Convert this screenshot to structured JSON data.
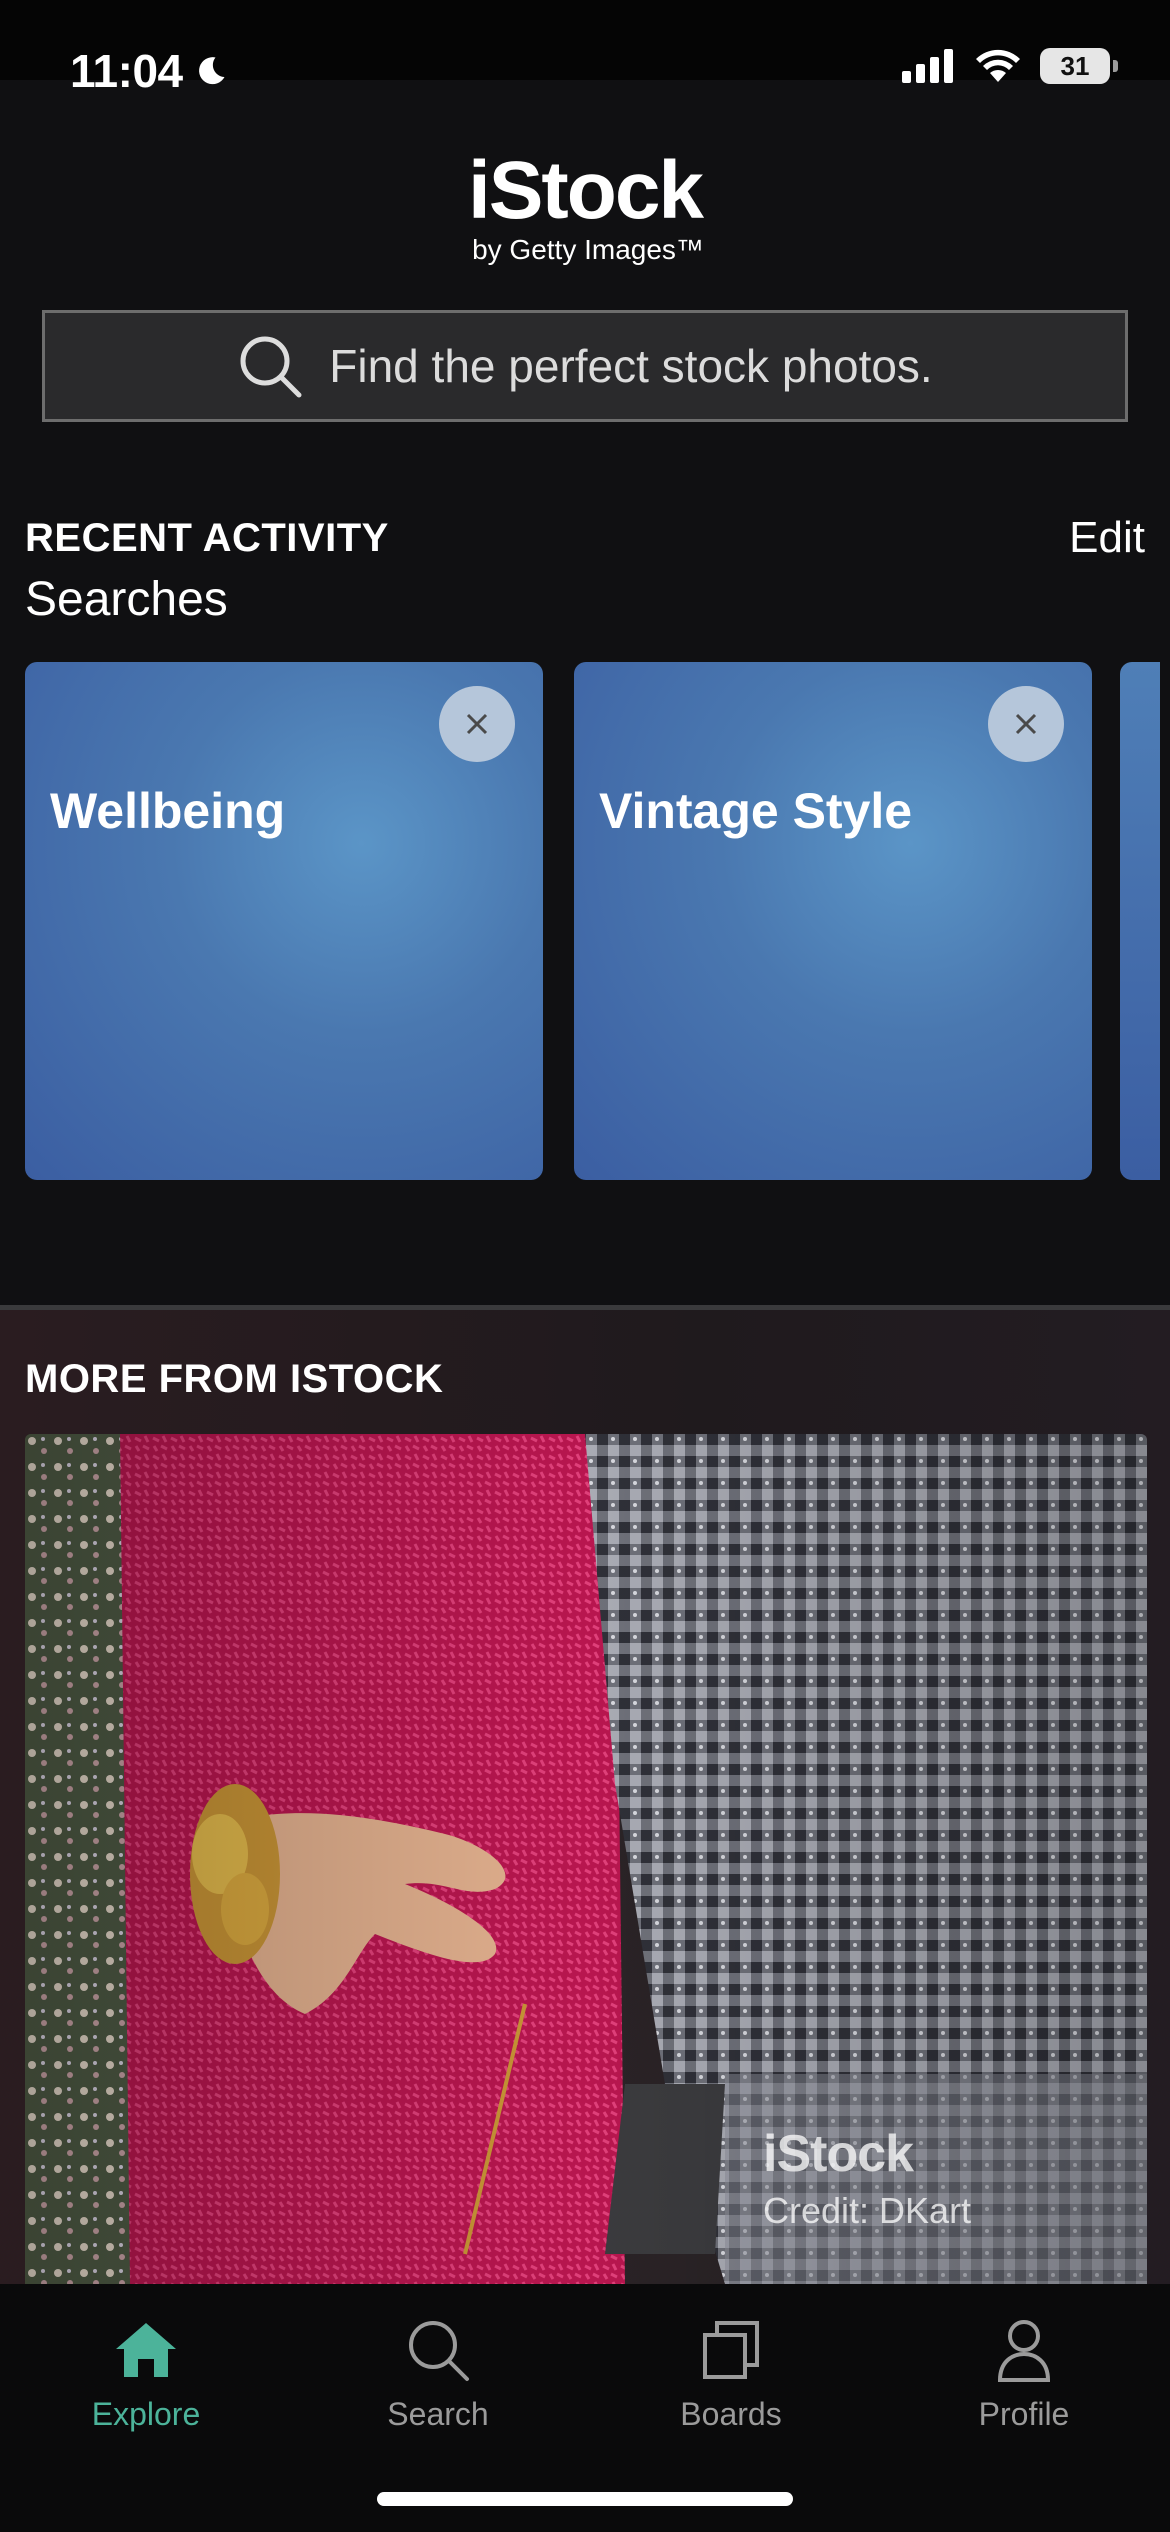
{
  "status_bar": {
    "time": "11:04",
    "battery": "31"
  },
  "header": {
    "logo_main": "iStock",
    "logo_sub": "by Getty Images™"
  },
  "search": {
    "placeholder": "Find the perfect stock photos."
  },
  "recent_activity": {
    "title": "RECENT ACTIVITY",
    "edit_label": "Edit",
    "subtitle": "Searches",
    "cards": [
      {
        "label": "Wellbeing"
      },
      {
        "label": "Vintage Style"
      }
    ]
  },
  "more": {
    "title": "MORE FROM ISTOCK",
    "watermark_brand": "iStock",
    "watermark_credit": "Credit: DKart"
  },
  "tab_bar": {
    "tabs": [
      {
        "label": "Explore",
        "icon": "home-icon",
        "active": true
      },
      {
        "label": "Search",
        "icon": "search-icon",
        "active": false
      },
      {
        "label": "Boards",
        "icon": "boards-icon",
        "active": false
      },
      {
        "label": "Profile",
        "icon": "profile-icon",
        "active": false
      }
    ]
  },
  "colors": {
    "accent": "#4cb39a",
    "card_blue": "#4a78b0",
    "background": "#101012"
  }
}
